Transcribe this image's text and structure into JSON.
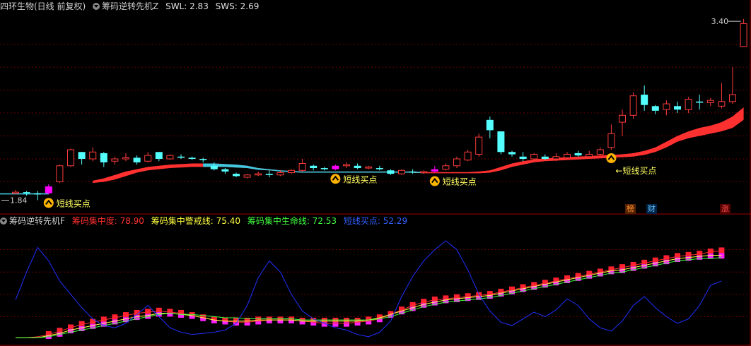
{
  "header": {
    "stock_title": "四环生物(日线 前复权)",
    "indicator_name": "筹码逆转先机Z",
    "swl_label": "SWL: 2.83",
    "sws_label": "SWS: 2.69"
  },
  "lower_header": {
    "indicator_name": "筹码逆转先机F",
    "items": [
      {
        "label": "筹码集中度: 78.90",
        "color": "#ff3030"
      },
      {
        "label": "筹码集中警戒线: 75.40",
        "color": "#ffff40"
      },
      {
        "label": "筹码集中生命线: 72.53",
        "color": "#40ff40"
      },
      {
        "label": "短线买点: 52.29",
        "color": "#3060ff"
      }
    ]
  },
  "badges": [
    {
      "text": "榜",
      "color": "#ff9030",
      "bg": "#552200"
    },
    {
      "text": "财",
      "color": "#60c0ff",
      "bg": "#002244"
    },
    {
      "text": "涨",
      "color": "#ff5050",
      "bg": "#550000"
    }
  ],
  "annotations": {
    "high_label": "3.40",
    "low_label": "1.84",
    "buy_signals": [
      {
        "day": 3,
        "label": "短线买点",
        "dir": "right"
      },
      {
        "day": 29,
        "label": "短线买点",
        "dir": "right"
      },
      {
        "day": 38,
        "label": "短线买点",
        "dir": "right"
      },
      {
        "day": 54,
        "label": "短线买点",
        "dir": "left"
      }
    ]
  },
  "colors": {
    "up": "#ff3b3b",
    "down": "#54ffff",
    "signal": "#ff00ff",
    "neutral": "#ffffff",
    "band": "#ff3030",
    "band_flat": "#40c8e0",
    "gridline": "#6a0000",
    "panel_border": "#a00000"
  },
  "chart_data": [
    {
      "type": "candlestick",
      "ylim": [
        1.8,
        3.45
      ],
      "candles": [
        [
          1.9,
          1.91,
          1.93,
          1.89
        ],
        [
          1.91,
          1.9,
          1.92,
          1.88
        ],
        [
          1.9,
          1.89,
          1.92,
          1.84
        ],
        [
          1.9,
          1.96,
          1.98,
          1.89
        ],
        [
          2.0,
          2.14,
          2.15,
          1.99
        ],
        [
          2.14,
          2.28,
          2.29,
          2.13
        ],
        [
          2.26,
          2.2,
          2.26,
          2.15
        ],
        [
          2.2,
          2.26,
          2.3,
          2.18
        ],
        [
          2.25,
          2.17,
          2.26,
          2.13
        ],
        [
          2.18,
          2.2,
          2.22,
          2.15
        ],
        [
          2.2,
          2.21,
          2.25,
          2.18
        ],
        [
          2.21,
          2.17,
          2.23,
          2.15
        ],
        [
          2.18,
          2.23,
          2.26,
          2.17
        ],
        [
          2.26,
          2.2,
          2.26,
          2.18
        ],
        [
          2.2,
          2.23,
          2.24,
          2.19
        ],
        [
          2.22,
          2.21,
          2.24,
          2.2
        ],
        [
          2.21,
          2.2,
          2.22,
          2.19
        ],
        [
          2.2,
          2.19,
          2.21,
          2.17
        ],
        [
          2.14,
          2.11,
          2.17,
          2.1
        ],
        [
          2.11,
          2.09,
          2.12,
          2.07
        ],
        [
          2.07,
          2.05,
          2.08,
          2.04
        ],
        [
          2.04,
          2.06,
          2.07,
          2.03
        ],
        [
          2.06,
          2.07,
          2.09,
          2.05
        ],
        [
          2.07,
          2.06,
          2.1,
          2.04
        ],
        [
          2.06,
          2.08,
          2.1,
          2.05
        ],
        [
          2.08,
          2.1,
          2.11,
          2.07
        ],
        [
          2.1,
          2.16,
          2.2,
          2.09
        ],
        [
          2.14,
          2.12,
          2.15,
          2.1
        ],
        [
          2.12,
          2.11,
          2.13,
          2.1
        ],
        [
          2.11,
          2.14,
          2.15,
          2.1
        ],
        [
          2.14,
          2.15,
          2.17,
          2.12
        ],
        [
          2.14,
          2.12,
          2.16,
          2.11
        ],
        [
          2.12,
          2.13,
          2.14,
          2.11
        ],
        [
          2.12,
          2.11,
          2.14,
          2.1
        ],
        [
          2.1,
          2.07,
          2.11,
          2.06
        ],
        [
          2.07,
          2.1,
          2.11,
          2.06
        ],
        [
          2.09,
          2.08,
          2.11,
          2.07
        ],
        [
          2.08,
          2.09,
          2.1,
          2.07
        ],
        [
          2.09,
          2.11,
          2.14,
          2.08
        ],
        [
          2.11,
          2.14,
          2.16,
          2.1
        ],
        [
          2.14,
          2.2,
          2.22,
          2.12
        ],
        [
          2.19,
          2.26,
          2.28,
          2.18
        ],
        [
          2.24,
          2.39,
          2.42,
          2.22
        ],
        [
          2.54,
          2.45,
          2.57,
          2.38
        ],
        [
          2.44,
          2.26,
          2.44,
          2.24
        ],
        [
          2.26,
          2.24,
          2.27,
          2.22
        ],
        [
          2.22,
          2.2,
          2.26,
          2.18
        ],
        [
          2.2,
          2.24,
          2.25,
          2.19
        ],
        [
          2.22,
          2.2,
          2.24,
          2.19
        ],
        [
          2.2,
          2.22,
          2.25,
          2.18
        ],
        [
          2.21,
          2.24,
          2.26,
          2.2
        ],
        [
          2.25,
          2.23,
          2.27,
          2.22
        ],
        [
          2.22,
          2.24,
          2.27,
          2.21
        ],
        [
          2.24,
          2.28,
          2.3,
          2.23
        ],
        [
          2.3,
          2.42,
          2.5,
          2.28
        ],
        [
          2.52,
          2.58,
          2.63,
          2.4
        ],
        [
          2.58,
          2.75,
          2.78,
          2.55
        ],
        [
          2.76,
          2.67,
          2.84,
          2.62
        ],
        [
          2.66,
          2.62,
          2.67,
          2.59
        ],
        [
          2.63,
          2.68,
          2.71,
          2.58
        ],
        [
          2.66,
          2.63,
          2.7,
          2.6
        ],
        [
          2.63,
          2.72,
          2.74,
          2.6
        ],
        [
          2.7,
          2.69,
          2.76,
          2.63
        ],
        [
          2.69,
          2.71,
          2.73,
          2.66
        ],
        [
          2.66,
          2.7,
          2.86,
          2.64
        ],
        [
          2.7,
          2.76,
          3.0,
          2.68
        ],
        [
          3.18,
          3.38,
          3.42,
          3.18
        ]
      ],
      "signal_days": [
        3,
        29,
        38
      ],
      "band_upper": [
        2.01,
        2.03,
        2.06,
        2.09,
        2.11,
        2.13,
        2.14,
        2.15,
        2.155,
        2.16,
        2.16,
        2.16,
        2.155,
        2.15,
        2.14,
        2.12,
        2.11,
        2.1,
        2.095,
        2.09,
        2.09,
        2.09,
        2.09,
        2.09,
        2.09,
        2.09,
        2.09,
        2.09,
        2.09,
        2.09,
        2.085,
        2.085,
        2.085,
        2.085,
        2.085,
        2.09,
        2.1,
        2.13,
        2.16,
        2.18,
        2.195,
        2.205,
        2.21,
        2.215,
        2.22,
        2.225,
        2.23,
        2.235,
        2.24,
        2.25,
        2.27,
        2.3,
        2.35,
        2.4,
        2.44,
        2.47,
        2.49,
        2.52,
        2.57,
        2.65
      ],
      "band_lower": [
        1.99,
        2.0,
        2.02,
        2.05,
        2.08,
        2.1,
        2.11,
        2.12,
        2.125,
        2.13,
        2.13,
        2.13,
        2.13,
        2.125,
        2.12,
        2.105,
        2.1,
        2.09,
        2.085,
        2.08,
        2.08,
        2.08,
        2.08,
        2.08,
        2.08,
        2.08,
        2.08,
        2.08,
        2.08,
        2.08,
        2.075,
        2.075,
        2.075,
        2.075,
        2.075,
        2.075,
        2.08,
        2.1,
        2.13,
        2.15,
        2.17,
        2.18,
        2.185,
        2.19,
        2.195,
        2.2,
        2.205,
        2.21,
        2.215,
        2.22,
        2.235,
        2.26,
        2.3,
        2.35,
        2.38,
        2.4,
        2.42,
        2.44,
        2.47,
        2.54
      ],
      "band_start_day": 7,
      "band_flat_range": [
        17,
        37
      ]
    },
    {
      "type": "line",
      "ylim": [
        0,
        100
      ],
      "series": [
        {
          "name": "筹码集中度",
          "color": "#ff3030",
          "values": [
            1,
            1,
            2,
            4,
            7,
            10,
            13,
            15,
            17,
            19,
            21,
            23,
            24,
            25,
            24,
            23,
            21,
            19,
            17,
            16,
            15,
            15,
            16,
            17,
            17,
            17,
            16,
            15,
            14,
            14,
            14,
            15,
            16,
            18,
            22,
            26,
            30,
            33,
            35,
            36,
            37,
            38,
            39,
            40,
            42,
            44,
            46,
            48,
            50,
            52,
            54,
            56,
            58,
            60,
            62,
            64,
            66,
            68,
            70,
            72,
            74,
            75,
            76,
            78,
            79
          ]
        },
        {
          "name": "筹码集中警戒线",
          "color": "#ffff40",
          "values": [
            1,
            1,
            1,
            3,
            5,
            8,
            10,
            12,
            14,
            16,
            18,
            20,
            21,
            23,
            23,
            22,
            21,
            19,
            17,
            16,
            16,
            16,
            17,
            17,
            17,
            17,
            16,
            16,
            16,
            16,
            16,
            16,
            17,
            19,
            22,
            25,
            28,
            31,
            33,
            35,
            36,
            37,
            38,
            39,
            41,
            43,
            45,
            47,
            49,
            51,
            53,
            55,
            57,
            59,
            61,
            62,
            64,
            66,
            68,
            70,
            72,
            73,
            74,
            75,
            75
          ]
        },
        {
          "name": "筹码集中生命线",
          "color": "#40ff40",
          "values": [
            1,
            1,
            1,
            2,
            4,
            6,
            8,
            10,
            12,
            14,
            16,
            18,
            20,
            22,
            23,
            22,
            22,
            21,
            20,
            19,
            19,
            18,
            18,
            18,
            18,
            18,
            17,
            17,
            17,
            17,
            17,
            17,
            17,
            18,
            20,
            23,
            26,
            29,
            31,
            33,
            34,
            35,
            36,
            37,
            39,
            41,
            43,
            45,
            47,
            49,
            51,
            53,
            55,
            57,
            59,
            60,
            62,
            64,
            66,
            68,
            70,
            71,
            72,
            72,
            73
          ]
        },
        {
          "name": "短线买点",
          "color": "#2030ff",
          "values": [
            35,
            60,
            82,
            70,
            52,
            40,
            28,
            18,
            12,
            10,
            14,
            22,
            30,
            20,
            10,
            6,
            4,
            5,
            6,
            8,
            14,
            30,
            55,
            70,
            60,
            40,
            25,
            18,
            14,
            10,
            8,
            4,
            2,
            6,
            16,
            38,
            56,
            70,
            80,
            88,
            80,
            62,
            40,
            25,
            15,
            12,
            18,
            24,
            20,
            26,
            36,
            30,
            18,
            10,
            7,
            16,
            30,
            38,
            28,
            20,
            14,
            18,
            30,
            48,
            52
          ]
        }
      ],
      "bar_span": [
        3,
        64
      ]
    }
  ]
}
